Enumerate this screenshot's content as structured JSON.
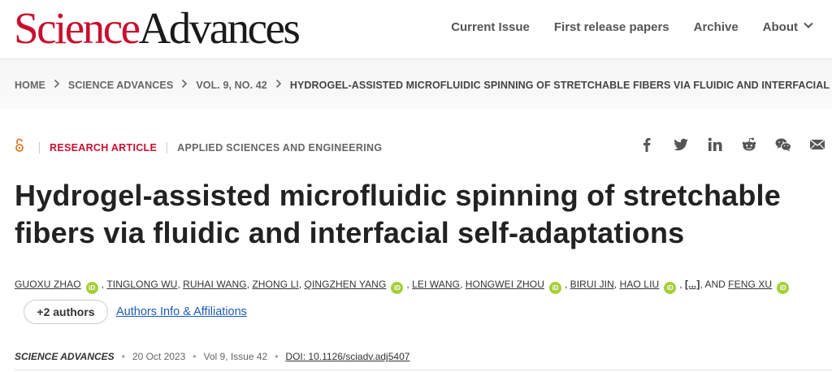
{
  "header": {
    "logo_part1": "Science",
    "logo_part2": "Advances",
    "nav": [
      "Current Issue",
      "First release papers",
      "Archive",
      "About"
    ]
  },
  "breadcrumb": [
    "HOME",
    "SCIENCE ADVANCES",
    "VOL. 9, NO. 42",
    "HYDROGEL-ASSISTED MICROFLUIDIC SPINNING OF STRETCHABLE FIBERS VIA FLUIDIC AND INTERFACIAL SEL..."
  ],
  "article": {
    "open_access_icon": "open-access-icon",
    "type": "RESEARCH ARTICLE",
    "subject": "APPLIED SCIENCES AND ENGINEERING",
    "title": "Hydrogel-assisted microfluidic spinning of stretchable fibers via fluidic and interfacial self-adaptations"
  },
  "share_icons": [
    "facebook-icon",
    "twitter-icon",
    "linkedin-icon",
    "reddit-icon",
    "wechat-icon",
    "email-icon"
  ],
  "authors": {
    "list": [
      {
        "name": "GUOXU ZHAO",
        "orcid": true
      },
      {
        "name": "TINGLONG WU",
        "orcid": false
      },
      {
        "name": "RUHAI WANG",
        "orcid": false
      },
      {
        "name": "ZHONG LI",
        "orcid": false
      },
      {
        "name": "QINGZHEN YANG",
        "orcid": true
      },
      {
        "name": "LEI WANG",
        "orcid": false
      },
      {
        "name": "HONGWEI ZHOU",
        "orcid": true
      },
      {
        "name": "BIRUI JIN",
        "orcid": false
      },
      {
        "name": "HAO LIU",
        "orcid": true
      },
      {
        "name": "FENG XU",
        "orcid": true
      }
    ],
    "orcid_label": "iD",
    "ellipsis": "[...]",
    "and": "AND",
    "more_button": "+2 authors",
    "affiliations_link": "Authors Info & Affiliations"
  },
  "publication": {
    "journal": "SCIENCE ADVANCES",
    "date": "20 Oct 2023",
    "volume": "Vol 9, Issue 42",
    "doi": "DOI: 10.1126/sciadv.adj5407",
    "separator": "•"
  },
  "colors": {
    "brand_red": "#c8102e",
    "link_blue": "#1e5bb8",
    "orcid_green": "#a6ce39",
    "oa_orange": "#e87722"
  }
}
